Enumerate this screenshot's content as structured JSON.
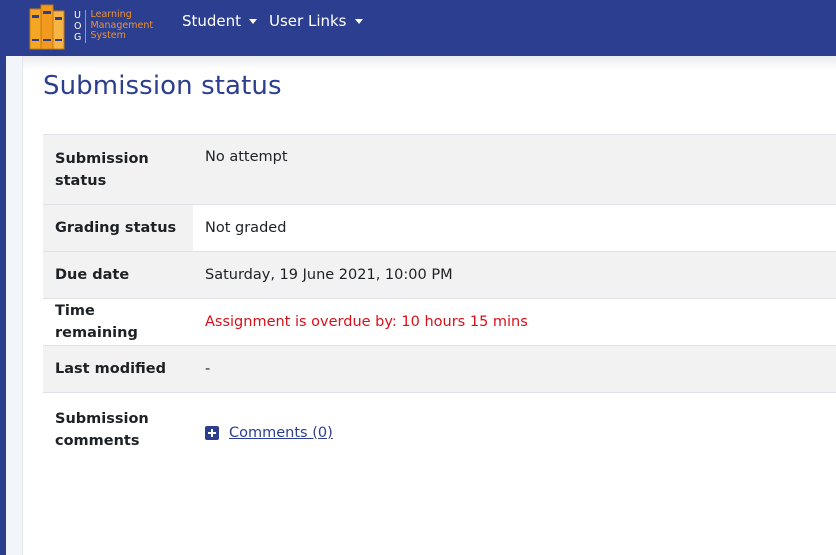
{
  "header": {
    "logo_letters": [
      "U",
      "O",
      "G"
    ],
    "logo_text_lines": [
      "Learning",
      "Management",
      "System"
    ],
    "nav_items": [
      {
        "label": "Student"
      },
      {
        "label": "User Links"
      }
    ]
  },
  "page": {
    "title": "Submission status"
  },
  "status_rows": [
    {
      "label": "Submission status",
      "value": "No attempt"
    },
    {
      "label": "Grading status",
      "value": "Not graded"
    },
    {
      "label": "Due date",
      "value": "Saturday, 19 June 2021, 10:00 PM"
    },
    {
      "label": "Time remaining",
      "value": "Assignment is overdue by: 10 hours 15 mins"
    },
    {
      "label": "Last modified",
      "value": "-"
    },
    {
      "label": "Submission comments",
      "value": "Comments (0)"
    }
  ],
  "colors": {
    "brand": "#2c3e8f",
    "accent": "#f0922b",
    "overdue": "#d9101a"
  }
}
